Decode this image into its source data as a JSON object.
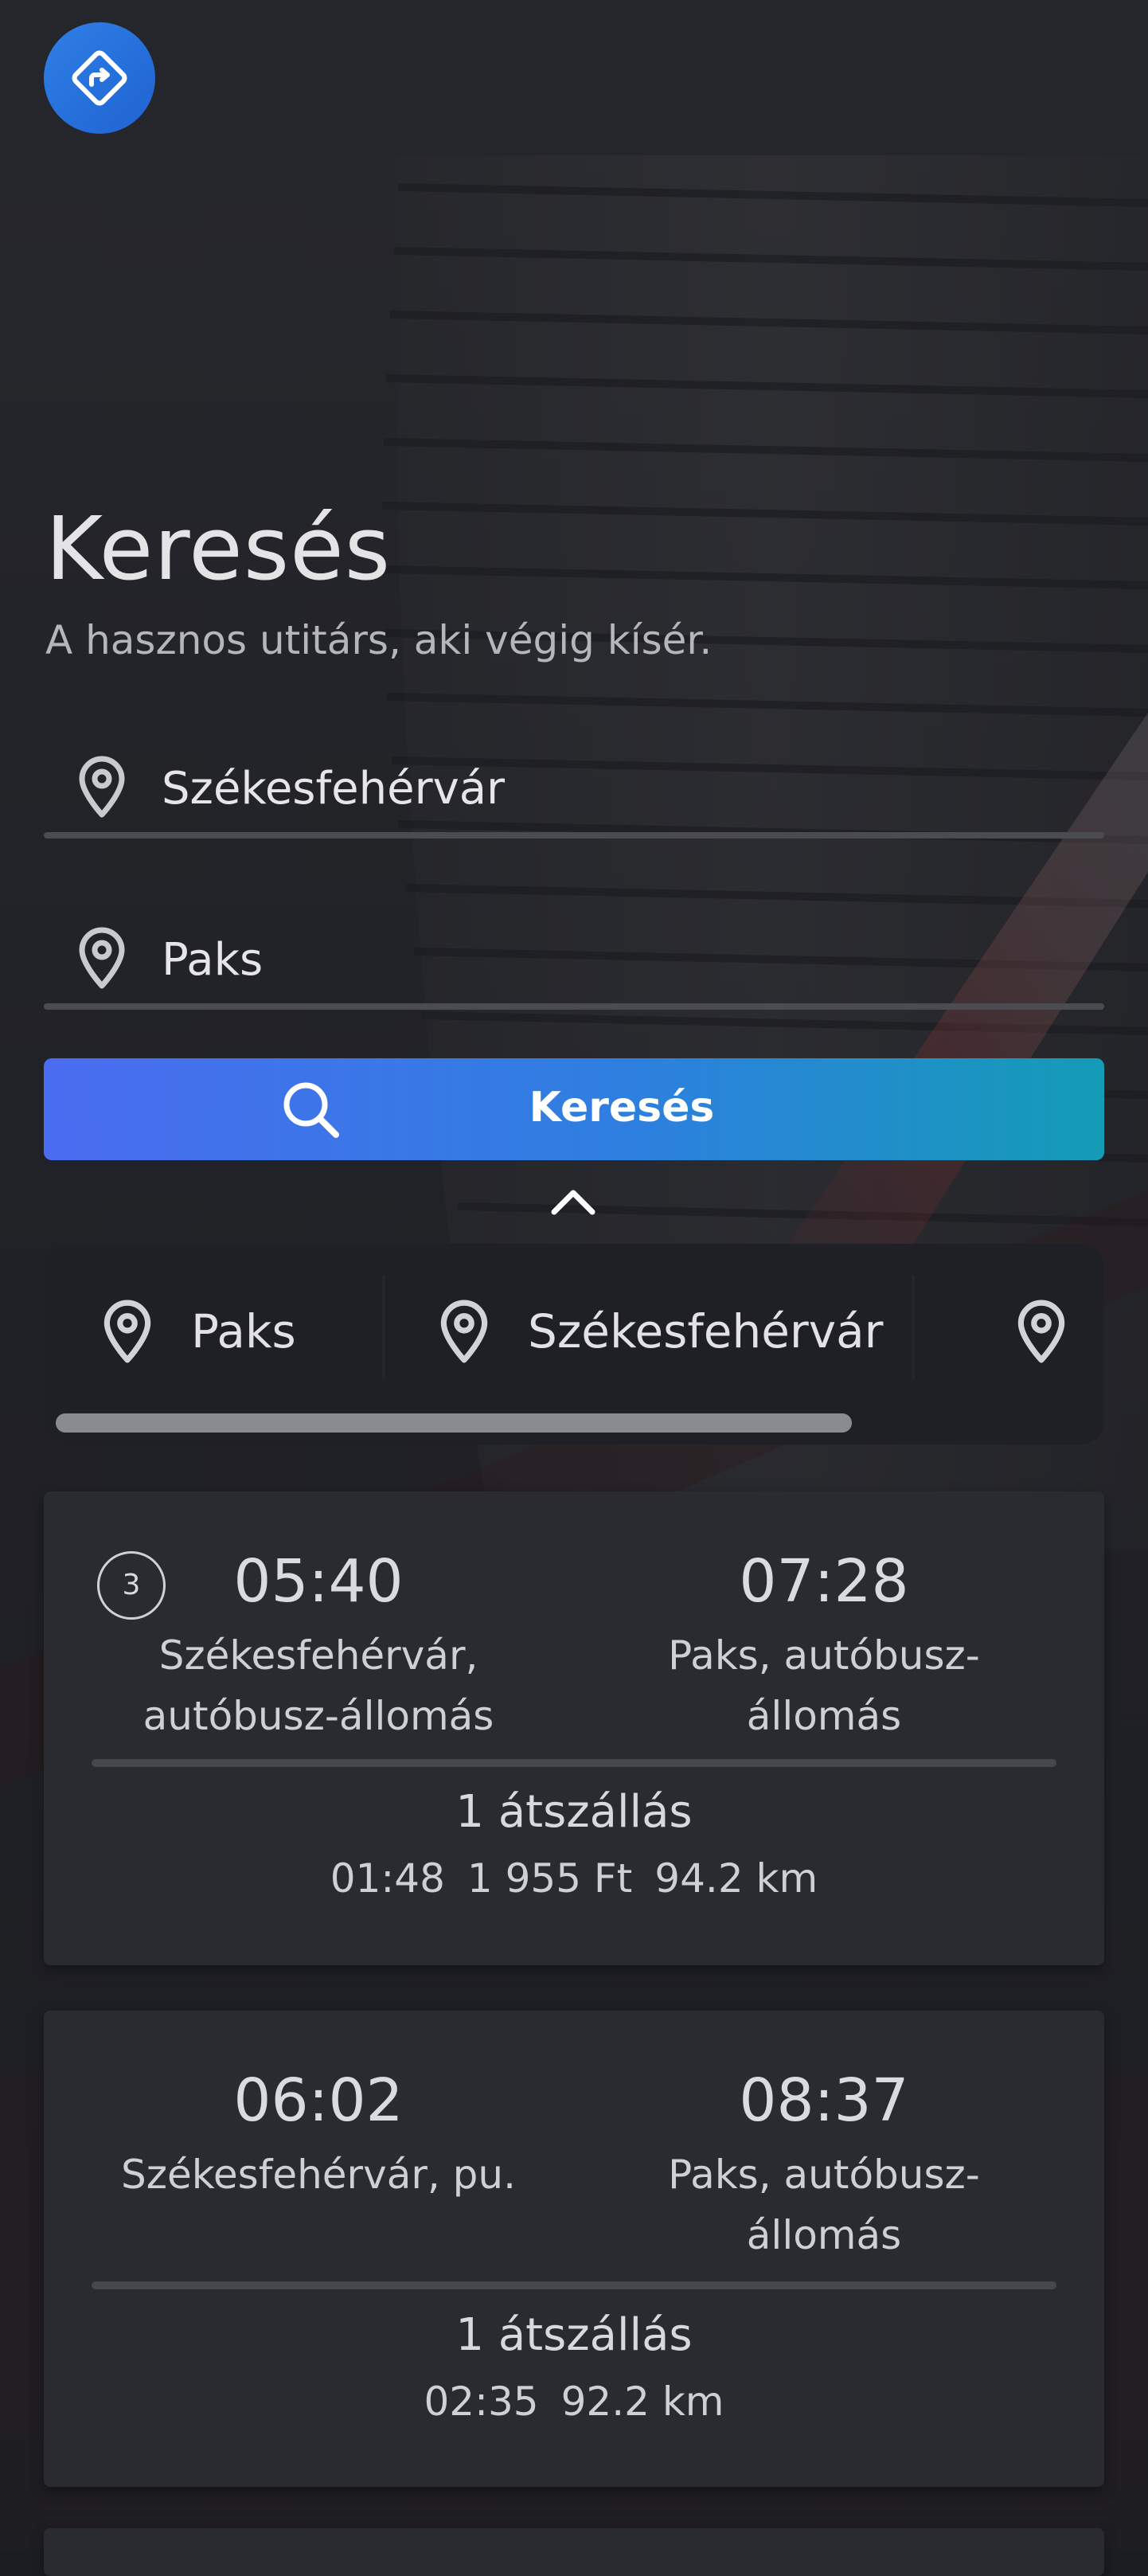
{
  "header": {
    "logo_icon": "directions-sign-icon"
  },
  "page": {
    "title": "Keresés",
    "subtitle": "A hasznos utitárs, aki végig kísér."
  },
  "search": {
    "from_value": "Székesfehérvár",
    "to_value": "Paks",
    "button_label": "Keresés",
    "button_icon": "search-icon",
    "collapse_icon": "chevron-up-icon"
  },
  "recent": {
    "items": [
      {
        "label": "Paks",
        "icon": "location-pin-icon"
      },
      {
        "label": "Székesfehérvár",
        "icon": "location-pin-icon"
      },
      {
        "label": "",
        "icon": "location-pin-icon"
      }
    ]
  },
  "results": [
    {
      "badge": "3",
      "depart_time": "05:40",
      "depart_place": "Székesfehérvár, autóbusz-állomás",
      "arrive_time": "07:28",
      "arrive_place": "Paks, autóbusz-állomás",
      "transfers": "1 átszállás",
      "duration": "01:48",
      "price": "1 955 Ft",
      "distance": "94.2 km"
    },
    {
      "badge": "",
      "depart_time": "06:02",
      "depart_place": "Székesfehérvár, pu.",
      "arrive_time": "08:37",
      "arrive_place": "Paks, autóbusz-állomás",
      "transfers": "1 átszállás",
      "duration": "02:35",
      "price": "",
      "distance": "92.2 km"
    }
  ],
  "colors": {
    "accent_start": "#4a6cf0",
    "accent_end": "#149cb6",
    "card_bg": "#2a2b30",
    "appbar_bg": "#25262b"
  }
}
